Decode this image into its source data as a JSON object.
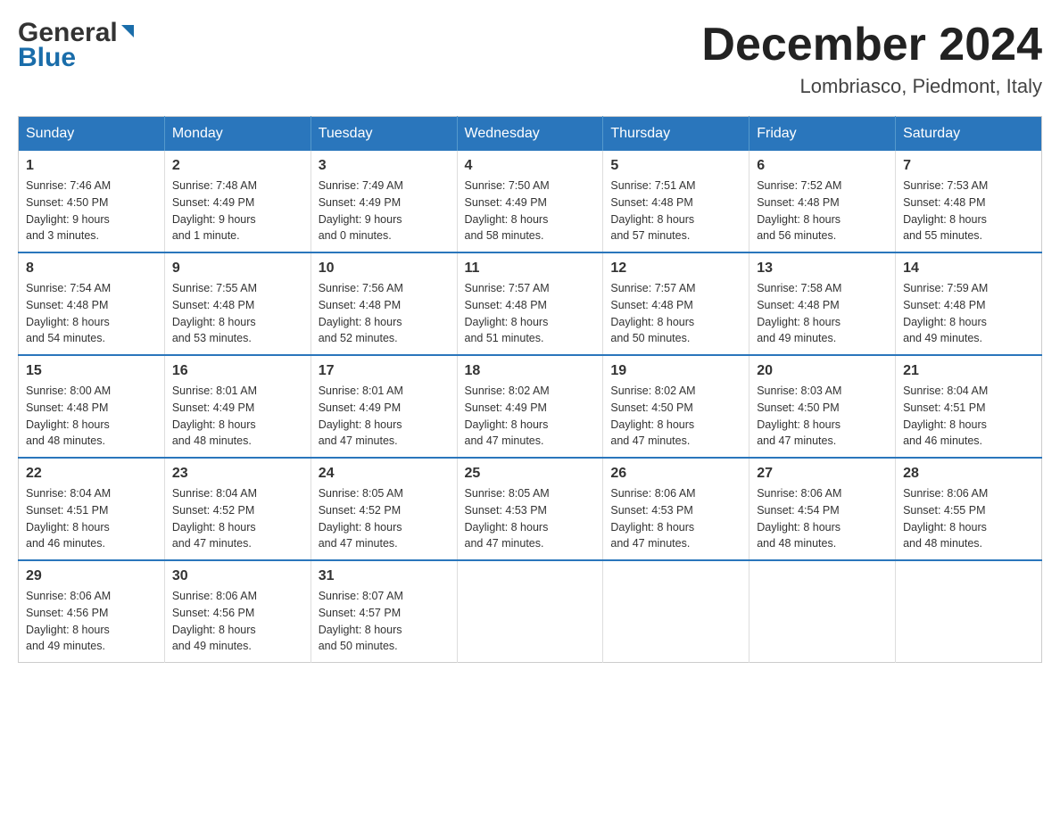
{
  "header": {
    "logo_top": "General",
    "logo_bottom": "Blue",
    "month_title": "December 2024",
    "location": "Lombriasco, Piedmont, Italy"
  },
  "weekdays": [
    "Sunday",
    "Monday",
    "Tuesday",
    "Wednesday",
    "Thursday",
    "Friday",
    "Saturday"
  ],
  "weeks": [
    [
      {
        "day": "1",
        "sunrise": "7:46 AM",
        "sunset": "4:50 PM",
        "daylight": "9 hours and 3 minutes."
      },
      {
        "day": "2",
        "sunrise": "7:48 AM",
        "sunset": "4:49 PM",
        "daylight": "9 hours and 1 minute."
      },
      {
        "day": "3",
        "sunrise": "7:49 AM",
        "sunset": "4:49 PM",
        "daylight": "9 hours and 0 minutes."
      },
      {
        "day": "4",
        "sunrise": "7:50 AM",
        "sunset": "4:49 PM",
        "daylight": "8 hours and 58 minutes."
      },
      {
        "day": "5",
        "sunrise": "7:51 AM",
        "sunset": "4:48 PM",
        "daylight": "8 hours and 57 minutes."
      },
      {
        "day": "6",
        "sunrise": "7:52 AM",
        "sunset": "4:48 PM",
        "daylight": "8 hours and 56 minutes."
      },
      {
        "day": "7",
        "sunrise": "7:53 AM",
        "sunset": "4:48 PM",
        "daylight": "8 hours and 55 minutes."
      }
    ],
    [
      {
        "day": "8",
        "sunrise": "7:54 AM",
        "sunset": "4:48 PM",
        "daylight": "8 hours and 54 minutes."
      },
      {
        "day": "9",
        "sunrise": "7:55 AM",
        "sunset": "4:48 PM",
        "daylight": "8 hours and 53 minutes."
      },
      {
        "day": "10",
        "sunrise": "7:56 AM",
        "sunset": "4:48 PM",
        "daylight": "8 hours and 52 minutes."
      },
      {
        "day": "11",
        "sunrise": "7:57 AM",
        "sunset": "4:48 PM",
        "daylight": "8 hours and 51 minutes."
      },
      {
        "day": "12",
        "sunrise": "7:57 AM",
        "sunset": "4:48 PM",
        "daylight": "8 hours and 50 minutes."
      },
      {
        "day": "13",
        "sunrise": "7:58 AM",
        "sunset": "4:48 PM",
        "daylight": "8 hours and 49 minutes."
      },
      {
        "day": "14",
        "sunrise": "7:59 AM",
        "sunset": "4:48 PM",
        "daylight": "8 hours and 49 minutes."
      }
    ],
    [
      {
        "day": "15",
        "sunrise": "8:00 AM",
        "sunset": "4:48 PM",
        "daylight": "8 hours and 48 minutes."
      },
      {
        "day": "16",
        "sunrise": "8:01 AM",
        "sunset": "4:49 PM",
        "daylight": "8 hours and 48 minutes."
      },
      {
        "day": "17",
        "sunrise": "8:01 AM",
        "sunset": "4:49 PM",
        "daylight": "8 hours and 47 minutes."
      },
      {
        "day": "18",
        "sunrise": "8:02 AM",
        "sunset": "4:49 PM",
        "daylight": "8 hours and 47 minutes."
      },
      {
        "day": "19",
        "sunrise": "8:02 AM",
        "sunset": "4:50 PM",
        "daylight": "8 hours and 47 minutes."
      },
      {
        "day": "20",
        "sunrise": "8:03 AM",
        "sunset": "4:50 PM",
        "daylight": "8 hours and 47 minutes."
      },
      {
        "day": "21",
        "sunrise": "8:04 AM",
        "sunset": "4:51 PM",
        "daylight": "8 hours and 46 minutes."
      }
    ],
    [
      {
        "day": "22",
        "sunrise": "8:04 AM",
        "sunset": "4:51 PM",
        "daylight": "8 hours and 46 minutes."
      },
      {
        "day": "23",
        "sunrise": "8:04 AM",
        "sunset": "4:52 PM",
        "daylight": "8 hours and 47 minutes."
      },
      {
        "day": "24",
        "sunrise": "8:05 AM",
        "sunset": "4:52 PM",
        "daylight": "8 hours and 47 minutes."
      },
      {
        "day": "25",
        "sunrise": "8:05 AM",
        "sunset": "4:53 PM",
        "daylight": "8 hours and 47 minutes."
      },
      {
        "day": "26",
        "sunrise": "8:06 AM",
        "sunset": "4:53 PM",
        "daylight": "8 hours and 47 minutes."
      },
      {
        "day": "27",
        "sunrise": "8:06 AM",
        "sunset": "4:54 PM",
        "daylight": "8 hours and 48 minutes."
      },
      {
        "day": "28",
        "sunrise": "8:06 AM",
        "sunset": "4:55 PM",
        "daylight": "8 hours and 48 minutes."
      }
    ],
    [
      {
        "day": "29",
        "sunrise": "8:06 AM",
        "sunset": "4:56 PM",
        "daylight": "8 hours and 49 minutes."
      },
      {
        "day": "30",
        "sunrise": "8:06 AM",
        "sunset": "4:56 PM",
        "daylight": "8 hours and 49 minutes."
      },
      {
        "day": "31",
        "sunrise": "8:07 AM",
        "sunset": "4:57 PM",
        "daylight": "8 hours and 50 minutes."
      },
      null,
      null,
      null,
      null
    ]
  ],
  "labels": {
    "sunrise": "Sunrise:",
    "sunset": "Sunset:",
    "daylight": "Daylight:"
  }
}
